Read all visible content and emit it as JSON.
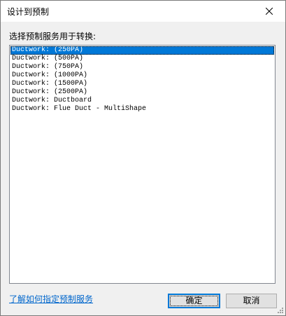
{
  "window": {
    "title": "设计到预制",
    "close_icon": "close-icon"
  },
  "prompt_label": "选择预制服务用于转换:",
  "list": {
    "selected_index": 0,
    "items": [
      "Ductwork: (250PA)",
      "Ductwork: (500PA)",
      "Ductwork: (750PA)",
      "Ductwork: (1000PA)",
      "Ductwork: (1500PA)",
      "Ductwork: (2500PA)",
      "Ductwork: Ductboard",
      "Ductwork: Flue Duct - MultiShape"
    ]
  },
  "help_link": "了解如何指定预制服务",
  "buttons": {
    "ok": "确定",
    "cancel": "取消"
  },
  "colors": {
    "selection": "#0078d7",
    "link": "#0066cc",
    "dialog_bg": "#f0f0f0"
  }
}
